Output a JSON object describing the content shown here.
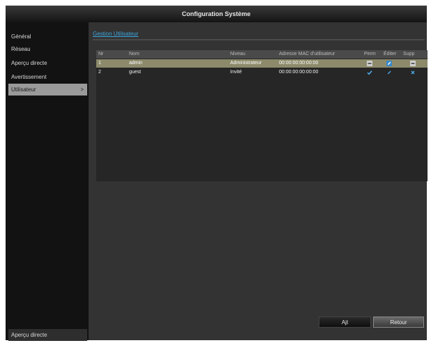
{
  "window": {
    "title": "Configuration Système"
  },
  "sidebar": {
    "items": [
      {
        "label": "Général"
      },
      {
        "label": "Réseau"
      },
      {
        "label": "Aperçu directe"
      },
      {
        "label": "Avertissement"
      },
      {
        "label": "Utilisateur",
        "arrow": ">"
      }
    ],
    "bottom_label": "Aperçu directe"
  },
  "main": {
    "tab_label": "Gestion Utilisateur",
    "table": {
      "headers": [
        "Nr",
        "Nom",
        "Niveau",
        "Adresse MAC d'utilisateur",
        "Perm",
        "Éditer",
        "Supp"
      ],
      "rows": [
        {
          "nr": "1",
          "name": "admin",
          "level": "Administrateur",
          "mac": "00:00:00:00:00:00",
          "perm_icon": "minus-icon",
          "edit_icon": "pencil-icon",
          "del_icon": "minus-icon"
        },
        {
          "nr": "2",
          "name": "guest",
          "level": "Invité",
          "mac": "00:00:00:00:00:00",
          "perm_icon": "check-icon",
          "edit_icon": "pencil-icon",
          "del_icon": "x-icon"
        }
      ]
    }
  },
  "footer": {
    "ok_label": "Ajt",
    "back_label": "Retour"
  },
  "colors": {
    "accent": "#3ea6e0",
    "selected_row": "#8c8a6a",
    "active_sidebar": "#9a9a9a"
  }
}
